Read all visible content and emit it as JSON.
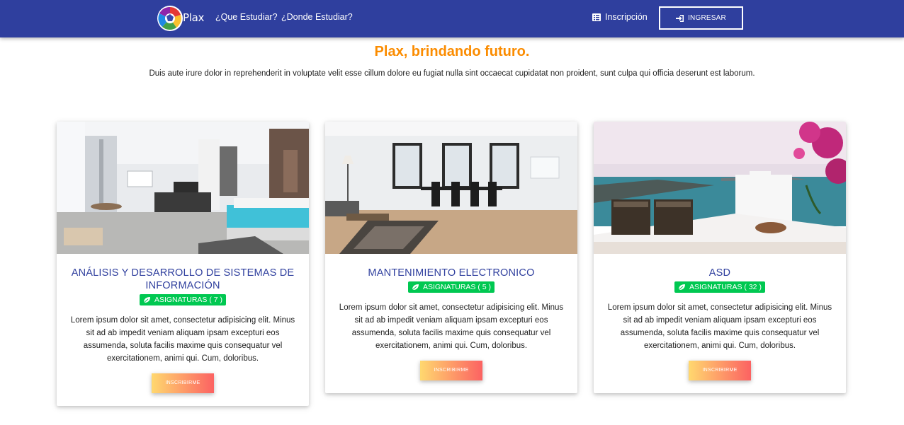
{
  "navbar": {
    "brand": "Plax",
    "links": [
      "¿Que Estudiar?",
      "¿Donde Estudiar?"
    ],
    "inscripcion_label": "Inscripción",
    "ingresar_label": "INGRESAR",
    "background_color": "#2f3f9e"
  },
  "hero": {
    "title": "Plax, brindando futuro.",
    "text": "Duis aute irure dolor in reprehenderit in voluptate velit esse cillum dolore eu fugiat nulla sint occaecat cupidatat non proident, sunt culpa qui officia deserunt est laborum.",
    "title_color": "#fb8c00"
  },
  "cards": [
    {
      "title": "ANÁLISIS Y DESARROLLO DE SISTEMAS DE INFORMACIÓN",
      "badge": "ASIGNATURAS ( 7 )",
      "text": "Lorem ipsum dolor sit amet, consectetur adipisicing elit. Minus sit ad ab impedit veniam aliquam ipsam excepturi eos assumenda, soluta facilis maxime quis consequatur vel exercitationem, animi qui. Cum, doloribus.",
      "button": "INSCRIBIRME",
      "image": "bedroom-photo"
    },
    {
      "title": "MANTENIMIENTO ELECTRONICO",
      "badge": "ASIGNATURAS ( 5 )",
      "text": "Lorem ipsum dolor sit amet, consectetur adipisicing elit. Minus sit ad ab impedit veniam aliquam ipsam excepturi eos assumenda, soluta facilis maxime quis consequatur vel exercitationem, animi qui. Cum, doloribus.",
      "button": "INSCRIBIRME",
      "image": "dining-room-photo"
    },
    {
      "title": "ASD",
      "badge": "ASIGNATURAS ( 32 )",
      "text": "Lorem ipsum dolor sit amet, consectetur adipisicing elit. Minus sit ad ab impedit veniam aliquam ipsam excepturi eos assumenda, soluta facilis maxime quis consequatur vel exercitationem, animi qui. Cum, doloribus.",
      "button": "INSCRIBIRME",
      "image": "terrace-sea-photo"
    }
  ],
  "colors": {
    "accent": "#2f3f9e",
    "badge": "#00c851",
    "button_gradient_start": "#ffd86f",
    "button_gradient_end": "#fc6262"
  }
}
